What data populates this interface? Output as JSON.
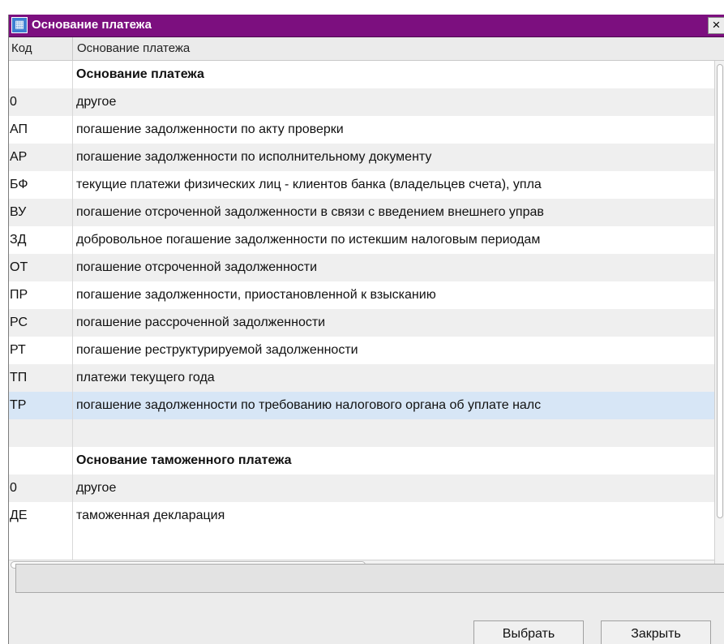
{
  "window": {
    "title": "Основание платежа",
    "icon": "app-calendar-icon",
    "close_glyph": "×"
  },
  "table": {
    "columns": [
      "Код",
      "Основание платежа"
    ],
    "rows": [
      {
        "code": "",
        "name": "Основание платежа",
        "type": "section"
      },
      {
        "code": "0",
        "name": "другое"
      },
      {
        "code": "АП",
        "name": "погашение задолженности по акту проверки"
      },
      {
        "code": "АР",
        "name": "погашение задолженности по исполнительному документу"
      },
      {
        "code": "БФ",
        "name": "текущие платежи физических лиц - клиентов  банка  (владельцев счета), упла"
      },
      {
        "code": "ВУ",
        "name": "погашение отсроченной задолженности в связи с введением внешнего управ"
      },
      {
        "code": "ЗД",
        "name": "добровольное погашение задолженности по истекшим налоговым периодам"
      },
      {
        "code": "ОТ",
        "name": "погашение отсроченной задолженности"
      },
      {
        "code": "ПР",
        "name": "погашение задолженности, приостановленной к взысканию"
      },
      {
        "code": "РС",
        "name": "погашение рассроченной задолженности"
      },
      {
        "code": "РТ",
        "name": "погашение реструктурируемой задолженности"
      },
      {
        "code": "ТП",
        "name": "платежи текущего года"
      },
      {
        "code": "ТР",
        "name": "погашение задолженности по требованию налогового органа об уплате налс",
        "selected": true
      },
      {
        "code": "",
        "name": ""
      },
      {
        "code": "",
        "name": "Основание таможенного платежа",
        "type": "section"
      },
      {
        "code": "0",
        "name": "другое"
      },
      {
        "code": "ДЕ",
        "name": "таможенная декларация"
      }
    ]
  },
  "status": {
    "text": ""
  },
  "buttons": {
    "select": "Выбрать",
    "close": "Закрыть"
  },
  "colors": {
    "titlebar": "#7c0f7f",
    "selected_row": "#d7e6f6",
    "stripe": "#efefef"
  }
}
